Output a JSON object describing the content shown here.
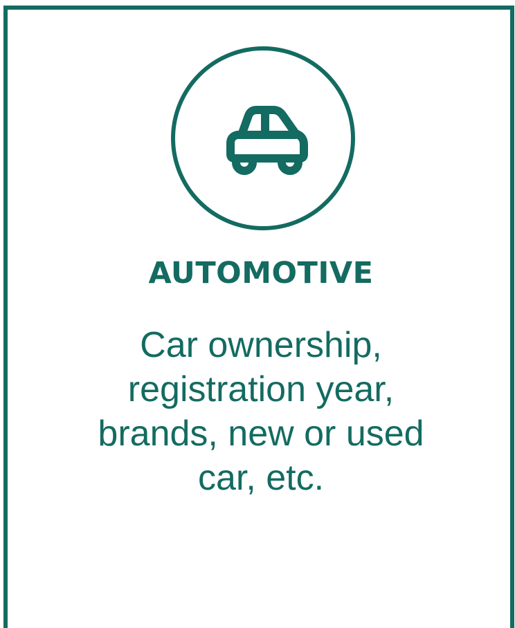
{
  "card": {
    "icon": "car-icon",
    "title": "AUTOMOTIVE",
    "description": "Car ownership, registration year, brands, new or used car, etc."
  },
  "colors": {
    "accent": "#136b61",
    "background": "#ffffff"
  }
}
